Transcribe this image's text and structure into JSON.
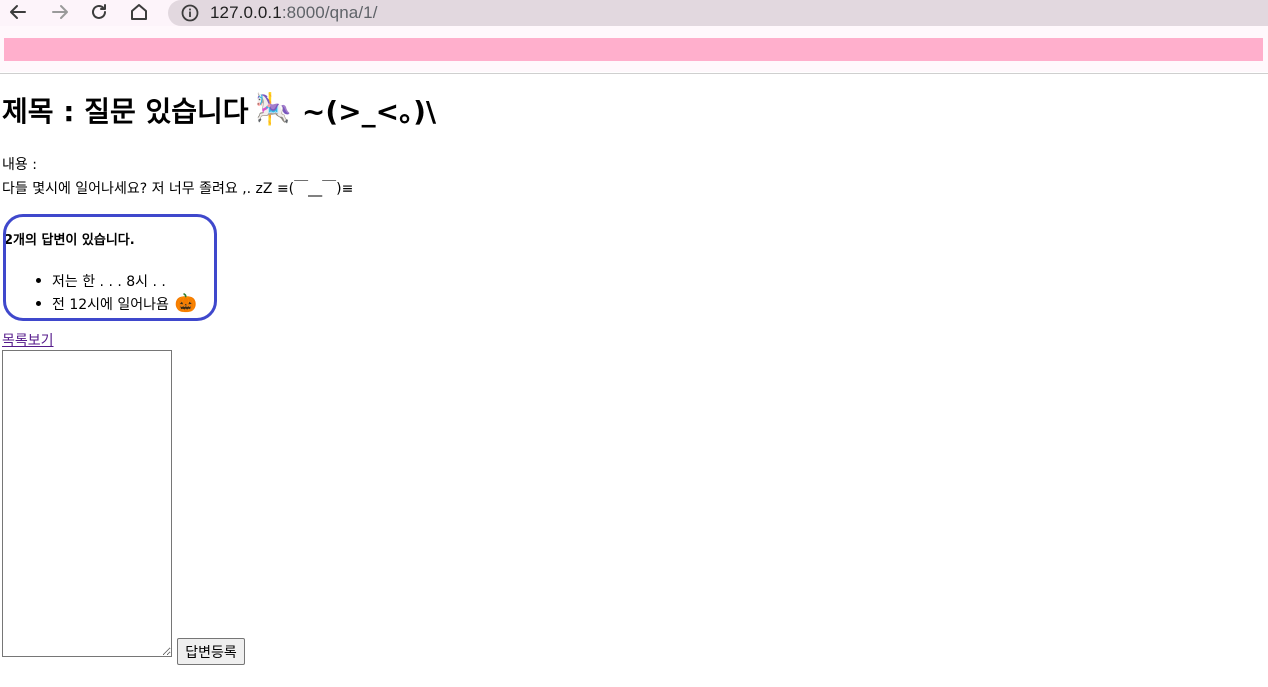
{
  "browser": {
    "url_host": "127.0.0.1",
    "url_rest": ":8000/qna/1/"
  },
  "question": {
    "title": "제목 : 질문 있습니다",
    "title_emoji": "🎠",
    "title_kaomoji": "~(>_<。)\\",
    "content_label": "내용 :",
    "content": "다들 몇시에 일어나세요? 저 너무 졸려요 ,. zZ ≡(￣__￣)≡"
  },
  "answers": {
    "count_text": "2개의 답변이 있습니다.",
    "items": [
      {
        "text": "저는 한 . . . 8시 . ."
      },
      {
        "text": "전 12시에 일어나욤",
        "emoji": "🎃"
      }
    ]
  },
  "list_link": "목록보기",
  "form": {
    "textarea_value": "",
    "submit_label": "답변등록"
  },
  "colors": {
    "banner": "#ffafcc",
    "answer_border": "#3f48cc",
    "link": "#551a8b"
  },
  "icons": [
    "back-arrow-icon",
    "forward-arrow-icon",
    "reload-icon",
    "home-icon",
    "info-icon"
  ]
}
